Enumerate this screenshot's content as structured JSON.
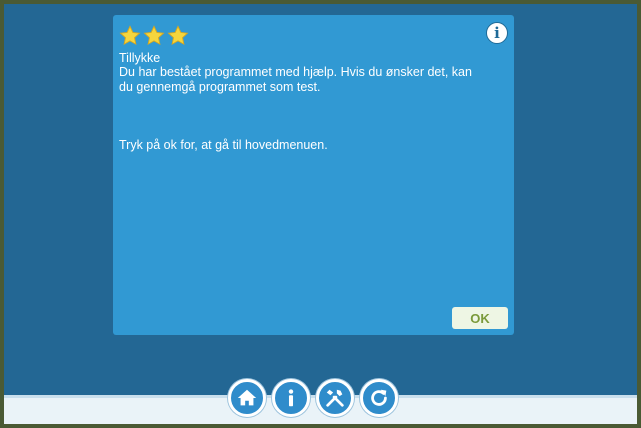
{
  "dialog": {
    "rating": 3,
    "rating_max": 3,
    "title": "Tillykke",
    "body": "Du har bestået programmet med hjælp. Hvis du ønsker det, kan du gennemgå programmet som test.",
    "instruction": "Tryk på ok for, at gå til hovedmenuen.",
    "info_icon": "i",
    "ok_label": "OK"
  },
  "toolbar": {
    "buttons": [
      {
        "icon": "home-icon"
      },
      {
        "icon": "info-icon"
      },
      {
        "icon": "tools-icon"
      },
      {
        "icon": "refresh-icon"
      }
    ]
  },
  "colors": {
    "frame": "#4a5a34",
    "background": "#236794",
    "dialog": "#3199d3",
    "star": "#f5d63d",
    "ok_text": "#7a9a3a",
    "bottom_bar": "#eaf3f8"
  }
}
